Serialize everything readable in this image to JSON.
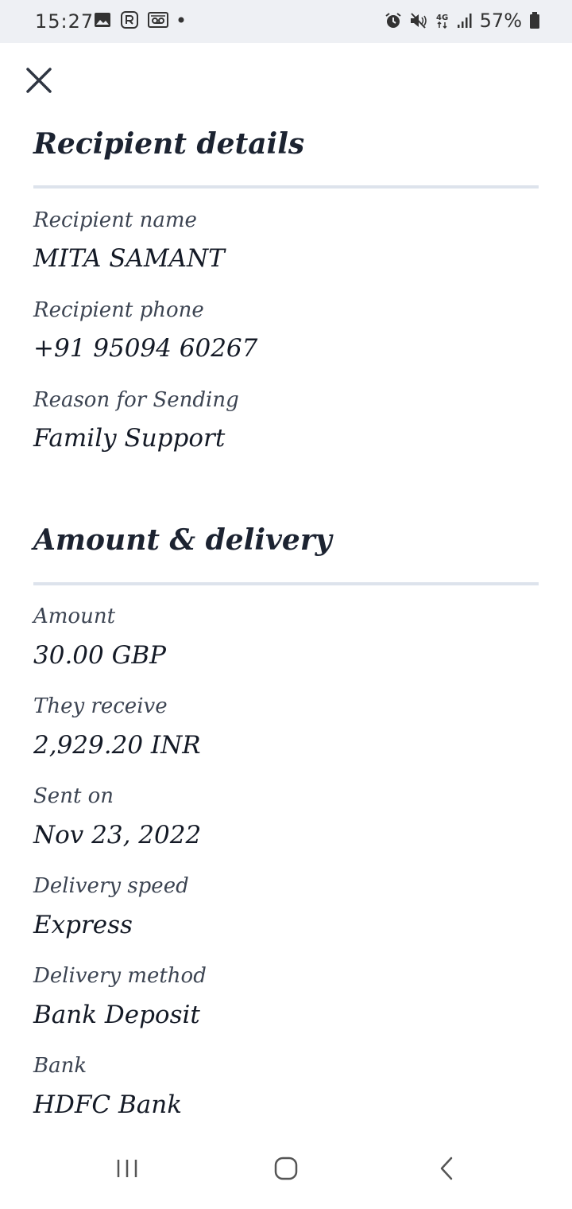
{
  "status_bar": {
    "time": "15:27",
    "battery": "57%",
    "network": "4G"
  },
  "sections": [
    {
      "title": "Recipient details",
      "fields": [
        {
          "label": "Recipient name",
          "value": "MITA SAMANT"
        },
        {
          "label": "Recipient phone",
          "value": "+91 95094 60267"
        },
        {
          "label": "Reason for Sending",
          "value": "Family Support"
        }
      ]
    },
    {
      "title": "Amount & delivery",
      "fields": [
        {
          "label": "Amount",
          "value": "30.00 GBP"
        },
        {
          "label": "They receive",
          "value": "2,929.20 INR"
        },
        {
          "label": "Sent on",
          "value": "Nov 23, 2022"
        },
        {
          "label": "Delivery speed",
          "value": "Express"
        },
        {
          "label": "Delivery method",
          "value": "Bank Deposit"
        },
        {
          "label": "Bank",
          "value": "HDFC Bank"
        }
      ]
    }
  ],
  "icons": {
    "close": "close-icon",
    "recents": "recent-apps-icon",
    "home": "home-icon",
    "back": "back-icon"
  }
}
